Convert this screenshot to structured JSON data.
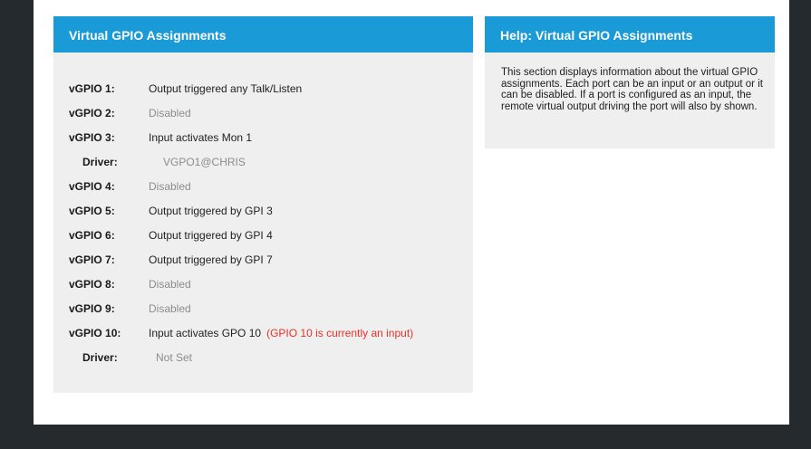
{
  "left_panel": {
    "title": "Virtual GPIO Assignments",
    "rows": [
      {
        "label": "vGPIO 1:",
        "value": "Output triggered any Talk/Listen"
      },
      {
        "label": "vGPIO 2:",
        "value": "Disabled"
      },
      {
        "label": "vGPIO 3:",
        "value": "Input activates Mon 1"
      },
      {
        "label": "Driver:",
        "value": "VGPO1@CHRIS"
      },
      {
        "label": "vGPIO 4:",
        "value": "Disabled"
      },
      {
        "label": "vGPIO 5:",
        "value": "Output triggered by GPI 3"
      },
      {
        "label": "vGPIO 6:",
        "value": "Output triggered by GPI 4"
      },
      {
        "label": "vGPIO 7:",
        "value": "Output triggered by GPI 7"
      },
      {
        "label": "vGPIO 8:",
        "value": "Disabled"
      },
      {
        "label": "vGPIO 9:",
        "value": "Disabled"
      },
      {
        "label": "vGPIO 10:",
        "value": "Input activates GPO 10",
        "note": "(GPIO 10 is currently an input)"
      },
      {
        "label": "Driver:",
        "value": "Not Set"
      }
    ]
  },
  "help_panel": {
    "title": "Help: Virtual GPIO Assignments",
    "text": "This section displays information about the virtual GPIO assignments. Each port can be an input or an output or it can be disabled. If a port is configured as an input, the remote virtual output driving the port will also by shown."
  },
  "colors": {
    "header_blue": "#1a9ad6",
    "panel_gray": "#efefef",
    "background_dark": "#252a2e",
    "note_red": "#e8312a",
    "disabled_gray": "#8c8c8c"
  }
}
